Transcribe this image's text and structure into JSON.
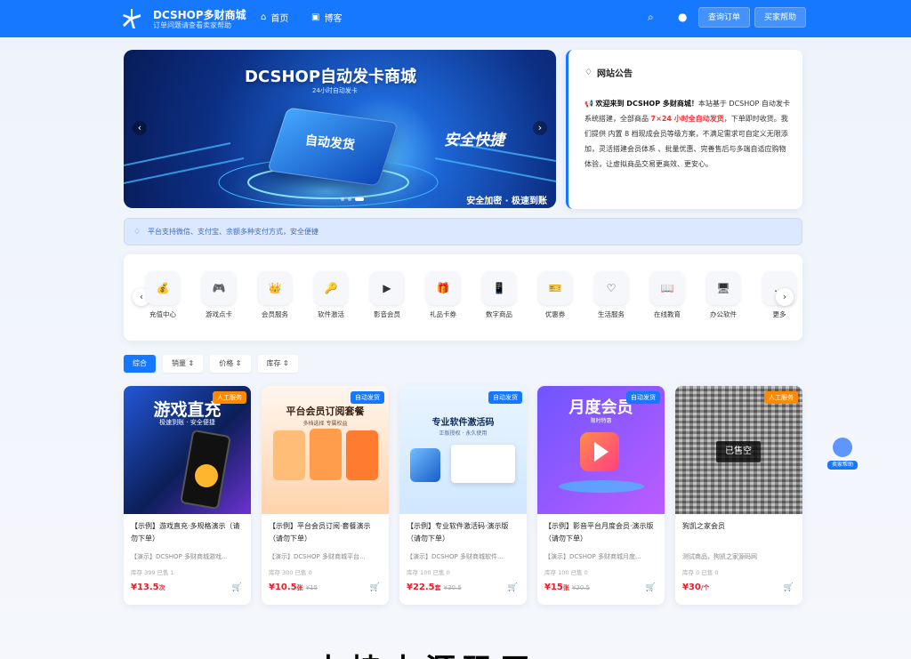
{
  "site": {
    "brand": "DCSHOP多财商城",
    "subtitle": "订单问题请查看卖家帮助"
  },
  "nav": [
    {
      "label": "首页"
    },
    {
      "label": "博客"
    }
  ],
  "header": {
    "search_icon": "search-icon",
    "user_icon": "user-icon",
    "order_btn": "查询订单",
    "help_btn": "买家帮助"
  },
  "banner": {
    "title": "DCSHOP自动发卡商城",
    "subtitle": "24小时自动发卡",
    "card_text": "自动发货",
    "speed_text": "安全快捷",
    "note": "安全加密 · 极速到账"
  },
  "notice": {
    "title": "网站公告",
    "part1": "欢迎来到 DCSHOP 多财商城！",
    "part2": "本站基于 DCSHOP 自动发卡系统搭建，全部商品 ",
    "red": "7×24 小时全自动发货",
    "part3": "，下单即时收货。我们提供 内置 8 档现成会员等级方案，不满足需求可自定义无限添加，灵活搭建会员体系 、批量优惠、完善售后与多端自适应购物体验，让虚拟商品交易更高效、更安心。"
  },
  "payline": {
    "text": "平台支持微信、支付宝、余额多种支付方式，安全便捷"
  },
  "categories": [
    {
      "label": "充值中心",
      "icon": "💰"
    },
    {
      "label": "游戏点卡",
      "icon": "🎮"
    },
    {
      "label": "会员服务",
      "icon": "👑"
    },
    {
      "label": "软件激活",
      "icon": "🔑"
    },
    {
      "label": "影音会员",
      "icon": "▶"
    },
    {
      "label": "礼品卡券",
      "icon": "🎁"
    },
    {
      "label": "数字商品",
      "icon": "📱"
    },
    {
      "label": "优惠券",
      "icon": "🎫"
    },
    {
      "label": "生活服务",
      "icon": "♡"
    },
    {
      "label": "在线教育",
      "icon": "📖"
    },
    {
      "label": "办公软件",
      "icon": "🖥"
    },
    {
      "label": "更多",
      "icon": "…"
    }
  ],
  "sort": [
    {
      "label": "综合"
    },
    {
      "label": "销量 ⇕"
    },
    {
      "label": "价格 ⇕"
    },
    {
      "label": "库存 ⇕"
    }
  ],
  "products": [
    {
      "img_title": "游戏直充",
      "img_sub": "极速到账 · 安全便捷",
      "tag": "人工服务",
      "name": "【示例】游戏直充·多规格演示（请勿下单）",
      "desc": "【演示】DCSHOP 多财商城游戏...",
      "stock": "库存 399    已售 1",
      "price": "¥13.5",
      "unit": "次",
      "old": ""
    },
    {
      "img_title": "平台会员订阅套餐",
      "img_sub": "多档选择 专属权益",
      "tag": "自动发货",
      "name": "【示例】平台会员订阅·套餐演示（请勿下单）",
      "desc": "【演示】DCSHOP 多财商城平台...",
      "stock": "库存 300    已售 0",
      "price": "¥10.5",
      "unit": "张",
      "old": "¥15"
    },
    {
      "img_title": "专业软件激活码",
      "img_sub": "正版授权 · 永久使用",
      "tag": "自动发货",
      "name": "【示例】专业软件激活码·演示版（请勿下单）",
      "desc": "【演示】DCSHOP 多财商城软件...",
      "stock": "库存 100    已售 0",
      "price": "¥22.5",
      "unit": "套",
      "old": "¥30.5"
    },
    {
      "img_title": "月度会员",
      "img_sub": "限时特惠",
      "tag": "自动发货",
      "name": "【示例】影音平台月度会员·演示版（请勿下单）",
      "desc": "【演示】DCSHOP 多财商城月度...",
      "stock": "库存 100    已售 0",
      "price": "¥15",
      "unit": "张",
      "old": "¥20.5"
    },
    {
      "img_title": "",
      "img_sub": "",
      "tag": "人工服务",
      "name": "狗凯之家会员",
      "desc": "测试商品，狗凯之家源码网",
      "stock": "库存 0    已售 0",
      "price": "¥30",
      "unit": "/个",
      "old": "",
      "soldout": "已售空"
    }
  ],
  "helper": {
    "label": "卖家帮助"
  },
  "bottom_text": "支持本源码平..."
}
